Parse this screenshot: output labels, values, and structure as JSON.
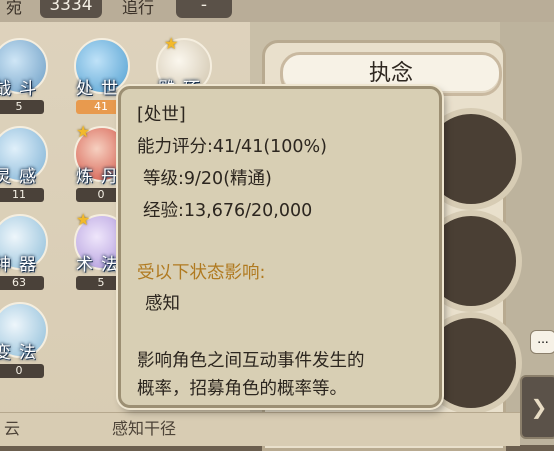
{
  "top_bar": {
    "left_label": "宛",
    "left_value": "3334",
    "mid_label": "追行",
    "mid_value": "-"
  },
  "skills": [
    {
      "name": "战斗",
      "level": "5",
      "color": "#8fb8d8"
    },
    {
      "name": "处世",
      "level": "41",
      "color": "#6fb2dc",
      "highlighted": true
    },
    {
      "name": "雕琢",
      "level": "",
      "color": "#e8e0cc",
      "starred": true
    },
    {
      "name": "灵感",
      "level": "11",
      "color": "#9cc4de"
    },
    {
      "name": "炼丹",
      "level": "0",
      "color": "#d85040",
      "starred": true
    },
    {
      "name": "神器",
      "level": "63",
      "color": "#a8cce0"
    },
    {
      "name": "术法",
      "level": "5",
      "color": "#c8b8e8",
      "starred": true
    },
    {
      "name": "变法",
      "level": "0",
      "color": "#a8cce0"
    }
  ],
  "right_panel": {
    "tab_label": "执念",
    "side_button_icon": "chevron-right-icon",
    "chat_icon": "speech-bubble-icon",
    "chat_text": "..."
  },
  "bottom_bar": {
    "left_text": "云",
    "mid_text": "感知干径"
  },
  "tooltip": {
    "title": "[处世]",
    "score": "能力评分:41/41(100%)",
    "level": "等级:9/20(精通)",
    "exp": "经验:13,676/20,000",
    "affected_header": "受以下状态影响:",
    "affected_item": "感知",
    "desc_line1": "影响角色之间互动事件发生的",
    "desc_line2": "概率，招募角色的概率等。"
  }
}
